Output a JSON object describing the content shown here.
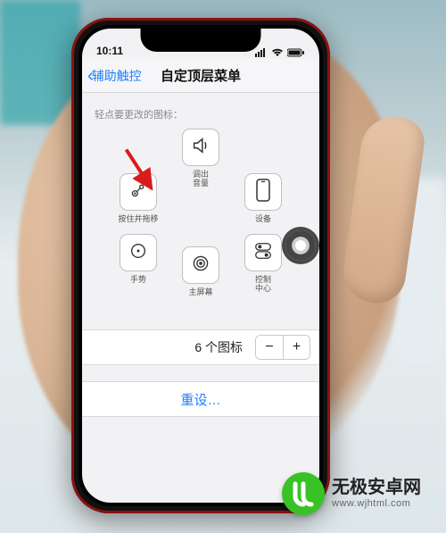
{
  "status": {
    "time": "10:11"
  },
  "nav": {
    "back_label": "辅助触控",
    "title": "自定顶层菜单"
  },
  "section_label": "轻点要更改的图标：",
  "tiles": {
    "volume": {
      "label": "调出\n音量"
    },
    "press": {
      "label": "按住并拖移"
    },
    "device": {
      "label": "设备"
    },
    "gesture": {
      "label": "手势"
    },
    "home": {
      "label": "主屏幕"
    },
    "control": {
      "label": "控制\n中心"
    }
  },
  "counter": {
    "label": "6 个图标",
    "minus": "−",
    "plus": "+"
  },
  "reset_label": "重设…",
  "watermark": {
    "brand": "无极安卓网",
    "url": "www.wjhtml.com"
  }
}
